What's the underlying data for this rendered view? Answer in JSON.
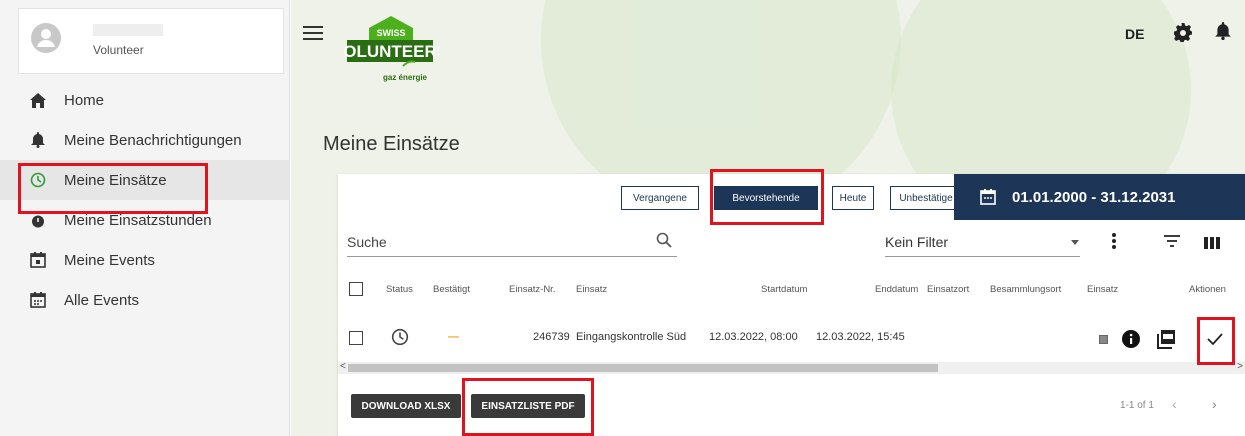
{
  "user": {
    "role": "Volunteer"
  },
  "sidebar": {
    "items": [
      {
        "label": "Home",
        "icon": "home-icon"
      },
      {
        "label": "Meine Benachrichtigungen",
        "icon": "bell-icon"
      },
      {
        "label": "Meine Einsätze",
        "icon": "clock-icon",
        "active": true
      },
      {
        "label": "Meine Einsatzstunden",
        "icon": "stopwatch-icon"
      },
      {
        "label": "Meine Events",
        "icon": "calendar-event-icon"
      },
      {
        "label": "Alle Events",
        "icon": "calendar-icon"
      }
    ]
  },
  "header": {
    "lang": "DE",
    "logo_text": "VOLUNTEERS",
    "logo_top": "SWISS",
    "logo_sub": "gaz énergie"
  },
  "page": {
    "title": "Meine Einsätze"
  },
  "filters": {
    "vergangene": "Vergangene",
    "bevorstehende": "Bevorstehende",
    "heute": "Heute",
    "unbestaetigte": "Unbestätige",
    "date_range": "01.01.2000 - 31.12.2031"
  },
  "search": {
    "label": "Suche",
    "filter": "Kein Filter"
  },
  "table": {
    "headers": [
      "Status",
      "Bestätigt",
      "Einsatz-Nr.",
      "Einsatz",
      "Startdatum",
      "Enddatum",
      "Einsatzort",
      "Besammlungsort",
      "Einsatz",
      "Aktionen"
    ],
    "rows": [
      {
        "bestaetigt": "—",
        "nr": "246739",
        "einsatz": "Eingangskontrolle Süd",
        "start": "12.03.2022, 08:00",
        "end": "12.03.2022, 15:45"
      }
    ]
  },
  "footer": {
    "download_xlsx": "DOWNLOAD XLSX",
    "einsatzliste_pdf": "EINSATZLISTE PDF",
    "pagination": "1-1 of 1"
  },
  "colors": {
    "accent": "#1d3557",
    "highlight": "#e0141e",
    "logo_green": "#4caf1c"
  }
}
